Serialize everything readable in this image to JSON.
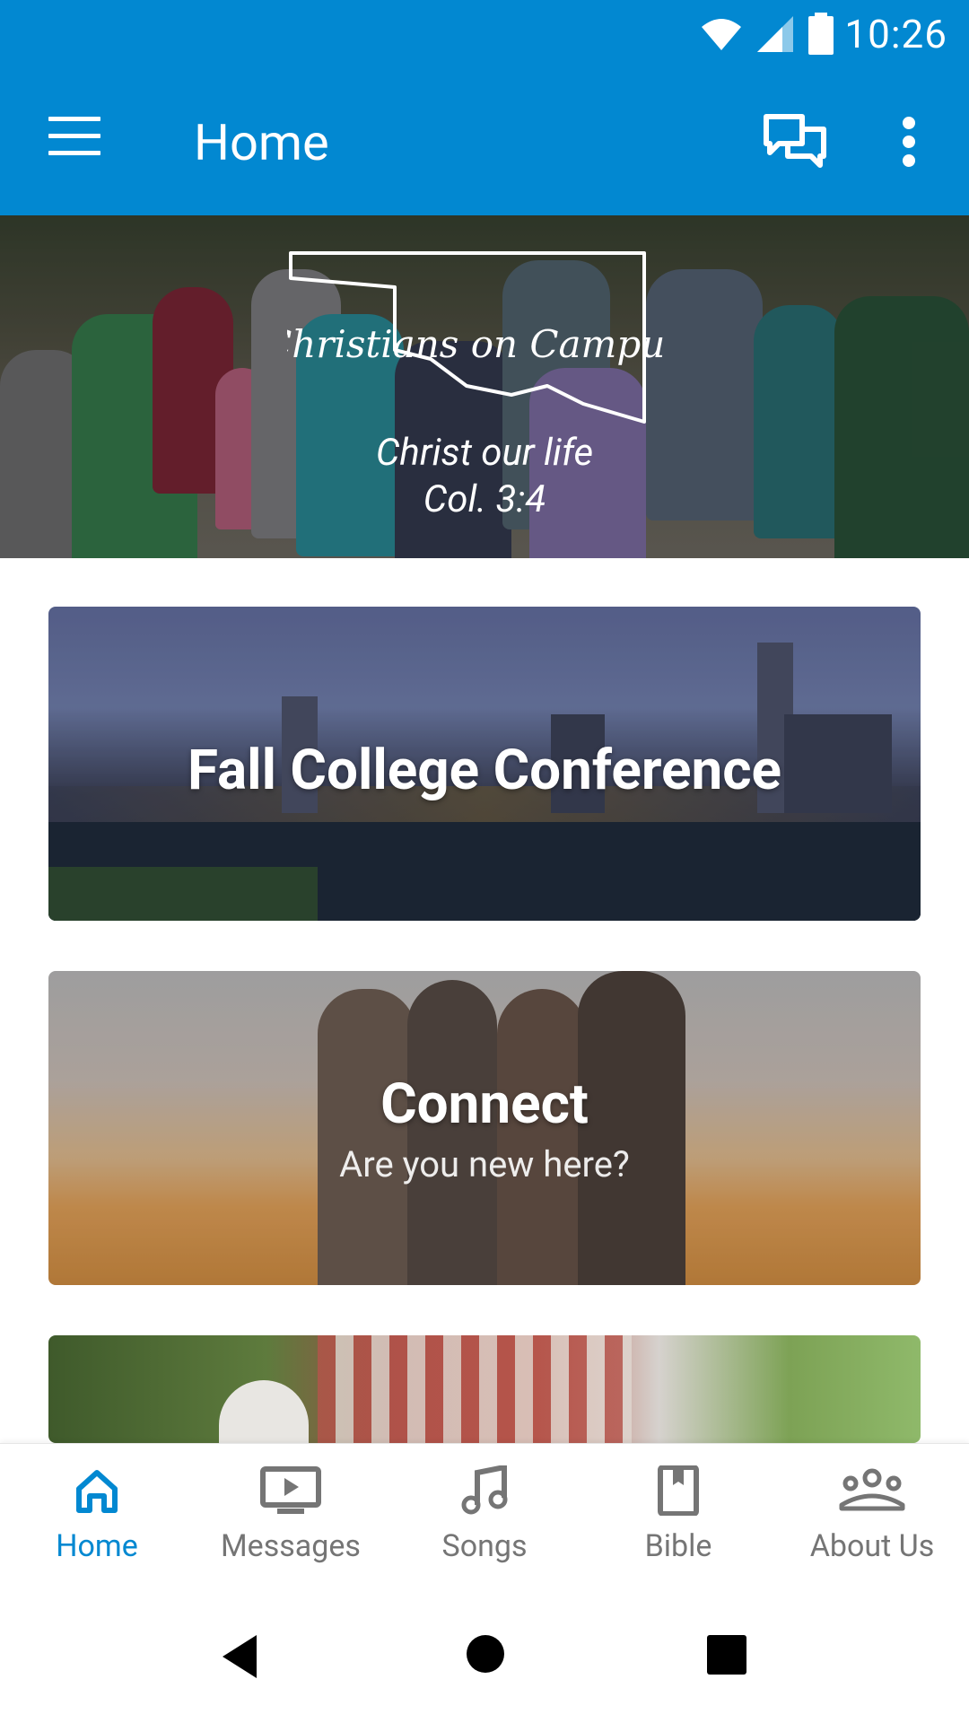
{
  "status_bar": {
    "time": "10:26",
    "icons": [
      "wifi-icon",
      "signal-icon",
      "battery-icon"
    ]
  },
  "app_bar": {
    "title": "Home",
    "actions": [
      "chat-icon",
      "more-vert-icon"
    ]
  },
  "hero": {
    "logo_text": "Christians on Campus",
    "line1": "Christ our life",
    "line2": "Col. 3:4"
  },
  "cards": [
    {
      "title": "Fall College Conference",
      "subtitle": ""
    },
    {
      "title": "Connect",
      "subtitle": "Are you new here?"
    }
  ],
  "bottom_nav": {
    "items": [
      {
        "label": "Home",
        "icon": "home-icon",
        "active": true
      },
      {
        "label": "Messages",
        "icon": "video-icon",
        "active": false
      },
      {
        "label": "Songs",
        "icon": "music-note-icon",
        "active": false
      },
      {
        "label": "Bible",
        "icon": "book-icon",
        "active": false
      },
      {
        "label": "About Us",
        "icon": "group-icon",
        "active": false
      }
    ]
  },
  "colors": {
    "primary": "#0288d1",
    "inactive": "#757575"
  }
}
